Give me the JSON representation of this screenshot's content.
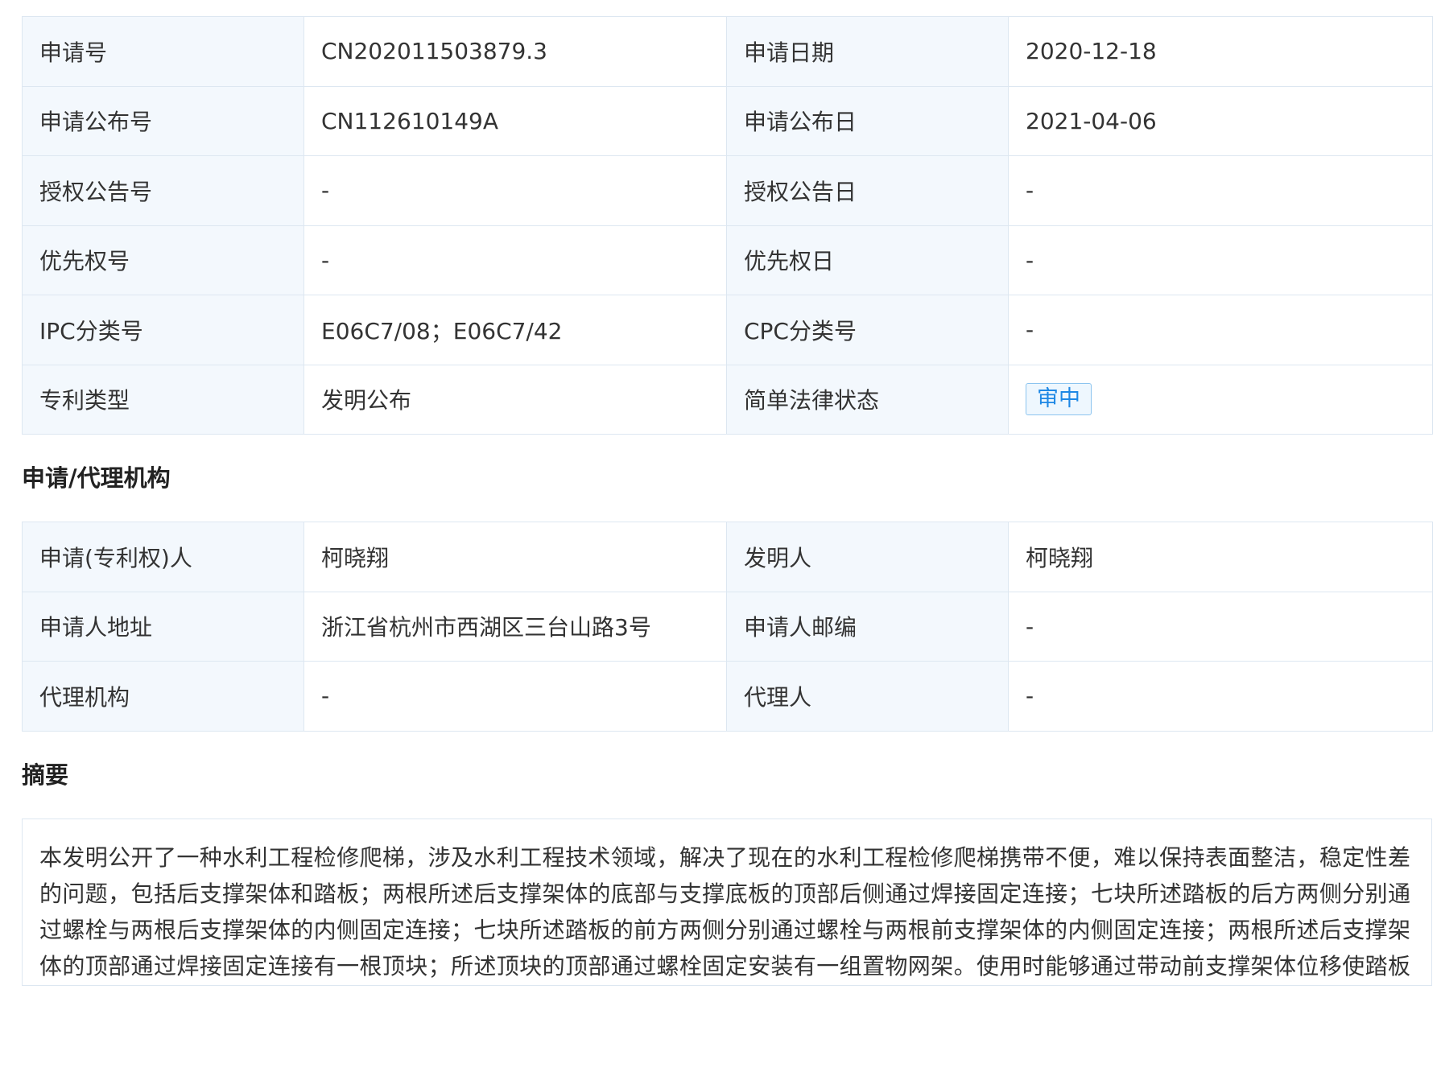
{
  "basic_info": {
    "rows": [
      {
        "l1": "申请号",
        "v1": "CN202011503879.3",
        "l2": "申请日期",
        "v2": "2020-12-18"
      },
      {
        "l1": "申请公布号",
        "v1": "CN112610149A",
        "l2": "申请公布日",
        "v2": "2021-04-06"
      },
      {
        "l1": "授权公告号",
        "v1": "-",
        "l2": "授权公告日",
        "v2": "-"
      },
      {
        "l1": "优先权号",
        "v1": "-",
        "l2": "优先权日",
        "v2": "-"
      },
      {
        "l1": "IPC分类号",
        "v1": "E06C7/08；E06C7/42",
        "l2": "CPC分类号",
        "v2": "-"
      },
      {
        "l1": "专利类型",
        "v1": "发明公布",
        "l2": "简单法律状态",
        "v2": "审中"
      }
    ],
    "status_badge_color": "#1e88e5"
  },
  "agency": {
    "title": "申请/代理机构",
    "rows": [
      {
        "l1": "申请(专利权)人",
        "v1": "柯晓翔",
        "l2": "发明人",
        "v2": "柯晓翔"
      },
      {
        "l1": "申请人地址",
        "v1": "浙江省杭州市西湖区三台山路3号",
        "l2": "申请人邮编",
        "v2": "-"
      },
      {
        "l1": "代理机构",
        "v1": "-",
        "l2": "代理人",
        "v2": "-"
      }
    ]
  },
  "abstract": {
    "title": "摘要",
    "text": "本发明公开了一种水利工程检修爬梯，涉及水利工程技术领域，解决了现在的水利工程检修爬梯携带不便，难以保持表面整洁，稳定性差的问题，包括后支撑架体和踏板；两根所述后支撑架体的底部与支撑底板的顶部后侧通过焊接固定连接；七块所述踏板的后方两侧分别通过螺栓与两根后支撑架体的内侧固定连接；七块所述踏板的前方两侧分别通过螺栓与两根前支撑架体的内侧固定连接；两根所述后支撑架体的顶部通过焊接固定连接有一根顶块；所述顶块的顶部通过螺栓固定安装有一组置物网架。使用时能够通过带动前支撑架体位移使踏板全部处于水平状态，在将爬梯的踏板展开时能够一次性全部展开，操作更加方便，而且展开后的稳固程度也大大提高。"
  },
  "colors": {
    "label_bg": "#f3f8fd",
    "border": "#dde7f1",
    "badge_border": "#8cc4ef"
  }
}
